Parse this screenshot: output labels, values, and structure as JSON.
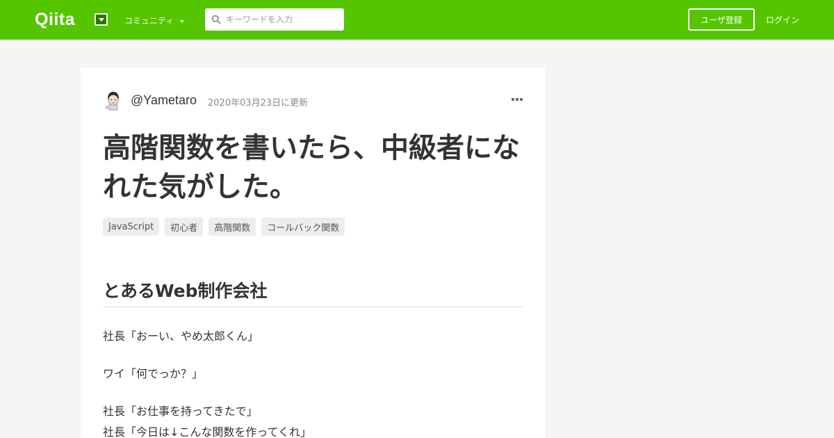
{
  "header": {
    "logo": "Qiita",
    "community_label": "コミュニティ",
    "search_placeholder": "キーワードを入力",
    "signup_label": "ユーザ登録",
    "login_label": "ログイン",
    "brand_color": "#55c500"
  },
  "article": {
    "author": "@Yametaro",
    "updated": "2020年03月23日に更新",
    "title": "高階関数を書いたら、中級者になれた気がした。",
    "tags": [
      "JavaScript",
      "初心者",
      "高階関数",
      "コールバック関数"
    ],
    "section_heading": "とあるWeb制作会社",
    "lines": [
      "社長「おーい、やめ太郎くん」",
      "ワイ「何でっか？」",
      "社長「お仕事を持ってきたで」",
      "社長「今日は↓こんな関数を作ってくれ」"
    ]
  }
}
